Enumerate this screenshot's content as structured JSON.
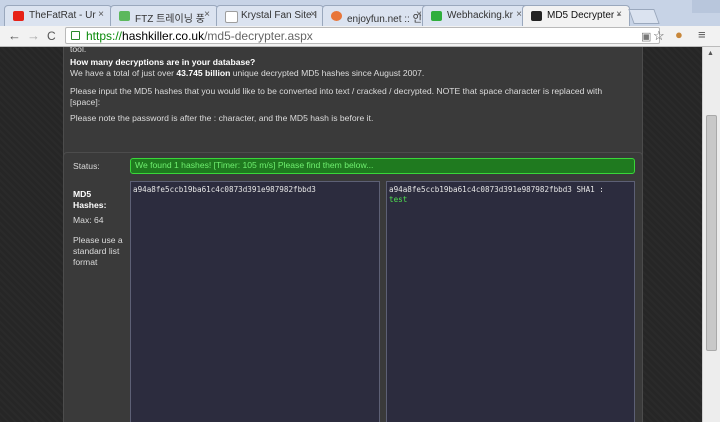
{
  "browser": {
    "tabs": [
      {
        "label": "TheFatRat - Ur",
        "icon": "youtube-icon",
        "color": "#e62117"
      },
      {
        "label": "FTZ 트레이닝 풍",
        "icon": "ftz-icon",
        "color": "#5cb85c"
      },
      {
        "label": "Krystal Fan Site I",
        "icon": "page-icon",
        "color": "#9e9e9e"
      },
      {
        "label": "enjoyfun.net :: 인",
        "icon": "enjoyfun-icon",
        "color": "#e8763a"
      },
      {
        "label": "Webhacking.kr",
        "icon": "webhacking-icon",
        "color": "#2fae3c"
      },
      {
        "label": "MD5 Decrypter -",
        "icon": "hashkiller-icon",
        "color": "#222222"
      }
    ],
    "url_scheme": "https://",
    "url_host": "hashkiller.co.uk",
    "url_path": "/md5-decrypter.aspx",
    "close_glyph": "×",
    "back_glyph": "←",
    "forward_glyph": "→",
    "reload_glyph": "C",
    "star_glyph": "☆",
    "menu_glyph": "≡"
  },
  "info": {
    "cut_line": "tool.",
    "heading": "How many decryptions are in your database?",
    "total_prefix": "We have a total of just over ",
    "total_count": "43.745 billion",
    "total_suffix": " unique decrypted MD5 hashes since August 2007.",
    "instructions": "Please input the MD5 hashes that you would like to be converted into text / cracked / decrypted. NOTE that space character is replaced with [space]:",
    "note": "Please note the password is after the : character, and the MD5 hash is before it."
  },
  "form": {
    "status_label": "Status:",
    "status_text": "We found 1 hashes! [Timer: 105 m/s] Please find them below...",
    "md5_label": "MD5 Hashes:",
    "max_label": "Max: 64",
    "help_text": "Please use a standard list format",
    "input_value": "a94a8fe5ccb19ba61c4c0873d391e987982fbbd3",
    "output_hash": "a94a8fe5ccb19ba61c4c0873d391e987982fbbd3 SHA1 :",
    "output_result": "test"
  }
}
